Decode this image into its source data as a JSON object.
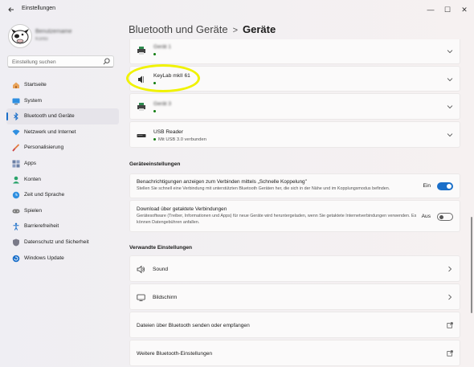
{
  "window": {
    "title": "Einstellungen",
    "back_icon": "back-arrow-icon",
    "minimize_glyph": "—",
    "maximize_glyph": "☐",
    "close_glyph": "✕"
  },
  "user": {
    "name": "Benutzername",
    "subtitle": "Konto"
  },
  "search": {
    "placeholder": "Einstellung suchen"
  },
  "sidebar": {
    "items": [
      {
        "label": "Startseite",
        "icon": "home-icon"
      },
      {
        "label": "System",
        "icon": "monitor-icon"
      },
      {
        "label": "Bluetooth und Geräte",
        "icon": "bluetooth-icon",
        "active": true
      },
      {
        "label": "Netzwerk und Internet",
        "icon": "wifi-icon"
      },
      {
        "label": "Personalisierung",
        "icon": "brush-icon"
      },
      {
        "label": "Apps",
        "icon": "apps-icon"
      },
      {
        "label": "Konten",
        "icon": "account-icon"
      },
      {
        "label": "Zeit und Sprache",
        "icon": "globe-clock-icon"
      },
      {
        "label": "Spielen",
        "icon": "gamepad-icon"
      },
      {
        "label": "Barrierefreiheit",
        "icon": "accessibility-icon"
      },
      {
        "label": "Datenschutz und Sicherheit",
        "icon": "shield-icon"
      },
      {
        "label": "Windows Update",
        "icon": "update-icon"
      }
    ]
  },
  "breadcrumb": {
    "parent": "Bluetooth und Geräte",
    "separator": ">",
    "current": "Geräte"
  },
  "devices": [
    {
      "name": "Gerät 1",
      "blurred": true,
      "icon": "printer-icon"
    },
    {
      "name": "KeyLab mkII 61",
      "blurred": false,
      "icon": "speaker-icon"
    },
    {
      "name": "Gerät 3",
      "blurred": true,
      "icon": "printer-icon"
    },
    {
      "name": "USB Reader",
      "status": "Mit USB 3.0 verbunden",
      "blurred": false,
      "icon": "usb-drive-icon"
    }
  ],
  "device_settings": {
    "title": "Geräteeinstellungen",
    "items": [
      {
        "title": "Benachrichtigungen anzeigen zum Verbinden mittels „Schnelle Koppelung\"",
        "description": "Stellen Sie schnell eine Verbindung mit unterstützten Bluetooth Geräten her, die sich in der Nähe und im Kopplungsmodus befinden.",
        "toggle_label": "Ein",
        "on": true
      },
      {
        "title": "Download über getaktete Verbindungen",
        "description": "Gerätesoftware (Treiber, Informationen und Apps) für neue Geräte wird heruntergeladen, wenn Sie getaktete Internetverbindungen verwenden. Es können Datengebühren anfallen.",
        "toggle_label": "Aus",
        "on": false
      }
    ]
  },
  "related": {
    "title": "Verwandte Einstellungen",
    "items": [
      {
        "label": "Sound",
        "icon": "speaker-icon",
        "trail": "chevron-right-icon"
      },
      {
        "label": "Bildschirm",
        "icon": "monitor-icon",
        "trail": "chevron-right-icon"
      },
      {
        "label": "Dateien über Bluetooth senden oder empfangen",
        "trail": "external-link-icon"
      },
      {
        "label": "Weitere Bluetooth-Einstellungen",
        "trail": "external-link-icon"
      }
    ]
  },
  "colors": {
    "accent": "#1a6fc9",
    "highlight": "#f0f200",
    "status_dot": "#107c10"
  }
}
